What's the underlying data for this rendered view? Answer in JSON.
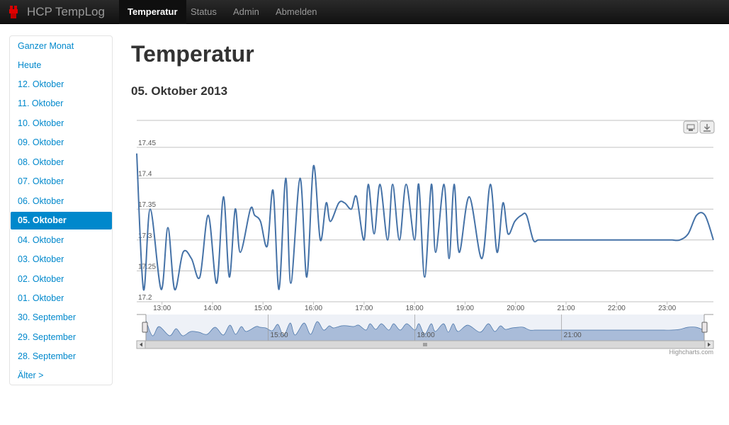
{
  "navbar": {
    "brand": "HCP TempLog",
    "items": [
      {
        "label": "Temperatur",
        "active": true
      },
      {
        "label": "Status",
        "active": false
      },
      {
        "label": "Admin",
        "active": false
      },
      {
        "label": "Abmelden",
        "active": false
      }
    ]
  },
  "sidebar": {
    "items": [
      {
        "label": "Ganzer Monat",
        "active": false
      },
      {
        "label": "Heute",
        "active": false
      },
      {
        "label": "12. Oktober",
        "active": false
      },
      {
        "label": "11. Oktober",
        "active": false
      },
      {
        "label": "10. Oktober",
        "active": false
      },
      {
        "label": "09. Oktober",
        "active": false
      },
      {
        "label": "08. Oktober",
        "active": false
      },
      {
        "label": "07. Oktober",
        "active": false
      },
      {
        "label": "06. Oktober",
        "active": false
      },
      {
        "label": "05. Oktober",
        "active": true
      },
      {
        "label": "04. Oktober",
        "active": false
      },
      {
        "label": "03. Oktober",
        "active": false
      },
      {
        "label": "02. Oktober",
        "active": false
      },
      {
        "label": "01. Oktober",
        "active": false
      },
      {
        "label": "30. September",
        "active": false
      },
      {
        "label": "29. September",
        "active": false
      },
      {
        "label": "28. September",
        "active": false
      },
      {
        "label": "Älter >",
        "active": false
      }
    ]
  },
  "page": {
    "title": "Temperatur",
    "subtitle": "05. Oktober 2013"
  },
  "chart": {
    "credit": "Highcharts.com",
    "navigator_ticks": [
      "15:00",
      "18:00",
      "21:00"
    ],
    "colors": {
      "line": "#4572a7",
      "navigator_fill": "#a9bcd9",
      "grid": "#c0c0c0"
    }
  },
  "chart_data": {
    "type": "line",
    "title": "",
    "xlabel": "",
    "ylabel": "",
    "xlim": [
      "12:30",
      "23:55"
    ],
    "ylim": [
      17.2,
      17.45
    ],
    "x_ticks": [
      "13:00",
      "14:00",
      "15:00",
      "16:00",
      "17:00",
      "18:00",
      "19:00",
      "20:00",
      "21:00",
      "22:00",
      "23:00"
    ],
    "y_ticks": [
      17.2,
      17.25,
      17.3,
      17.35,
      17.4,
      17.45
    ],
    "grid": true,
    "legend": "none",
    "series": [
      {
        "x": [
          "12:30",
          "12:38",
          "12:46",
          "12:59",
          "13:07",
          "13:15",
          "13:25",
          "13:35",
          "13:45",
          "13:55",
          "14:05",
          "14:13",
          "14:20",
          "14:27",
          "14:33",
          "14:45",
          "14:50",
          "14:57",
          "15:05",
          "15:12",
          "15:19",
          "15:27",
          "15:33",
          "15:44",
          "15:52",
          "16:00",
          "16:08",
          "16:15",
          "16:20",
          "16:30",
          "16:37",
          "16:45",
          "16:51",
          "17:00",
          "17:05",
          "17:12",
          "17:19",
          "17:28",
          "17:34",
          "17:42",
          "17:50",
          "18:00",
          "18:05",
          "18:12",
          "18:20",
          "18:25",
          "18:35",
          "18:41",
          "18:47",
          "18:53",
          "19:05",
          "19:20",
          "19:30",
          "19:38",
          "19:45",
          "19:51",
          "19:59",
          "20:07",
          "20:13",
          "20:21",
          "20:27",
          "20:35",
          "20:41",
          "20:49",
          "20:57",
          "21:04",
          "21:10",
          "21:18",
          "21:24",
          "21:32",
          "21:38",
          "21:47",
          "21:53",
          "22:01",
          "22:08",
          "22:16",
          "22:23",
          "22:31",
          "22:37",
          "22:45",
          "22:51",
          "23:00",
          "23:06",
          "23:15",
          "23:25",
          "23:35",
          "23:45",
          "23:55"
        ],
        "y": [
          17.44,
          17.22,
          17.35,
          17.22,
          17.32,
          17.22,
          17.28,
          17.27,
          17.24,
          17.34,
          17.23,
          17.37,
          17.24,
          17.35,
          17.28,
          17.35,
          17.34,
          17.33,
          17.29,
          17.38,
          17.22,
          17.4,
          17.23,
          17.4,
          17.24,
          17.42,
          17.3,
          17.36,
          17.33,
          17.36,
          17.36,
          17.35,
          17.37,
          17.3,
          17.39,
          17.31,
          17.39,
          17.3,
          17.39,
          17.3,
          17.39,
          17.3,
          17.39,
          17.24,
          17.39,
          17.28,
          17.39,
          17.27,
          17.39,
          17.28,
          17.37,
          17.27,
          17.39,
          17.28,
          17.36,
          17.31,
          17.33,
          17.34,
          17.34,
          17.3,
          17.3,
          17.3,
          17.3,
          17.3,
          17.3,
          17.3,
          17.3,
          17.3,
          17.3,
          17.3,
          17.3,
          17.3,
          17.3,
          17.3,
          17.3,
          17.3,
          17.3,
          17.3,
          17.3,
          17.3,
          17.3,
          17.3,
          17.3,
          17.3,
          17.31,
          17.34,
          17.34,
          17.3
        ]
      }
    ]
  }
}
